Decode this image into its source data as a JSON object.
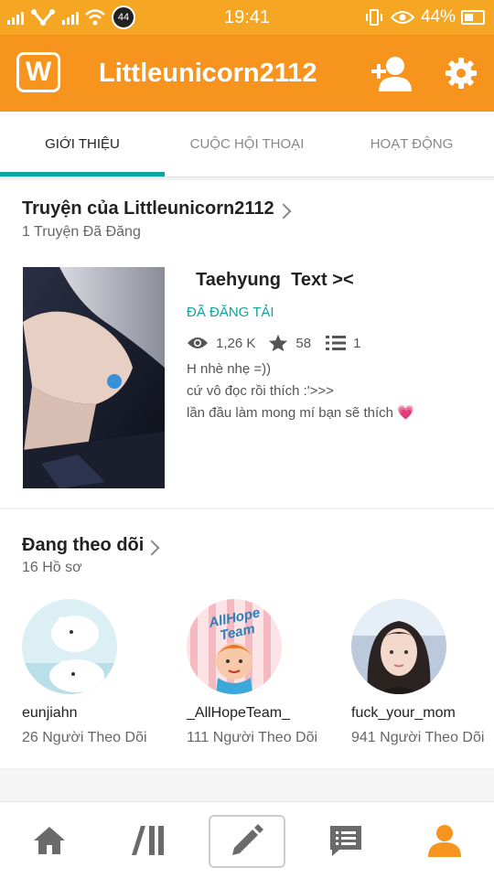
{
  "status_bar": {
    "time": "19:41",
    "notification_count": "44",
    "battery": "44%"
  },
  "app_bar": {
    "logo_letter": "W",
    "title": "Littleunicorn2112"
  },
  "tabs": [
    {
      "label": "GIỚI THIỆU",
      "active": true
    },
    {
      "label": "CUỘC HỘI THOẠI",
      "active": false
    },
    {
      "label": "HOẠT ĐỘNG",
      "active": false
    }
  ],
  "stories_section": {
    "title": "Truyện của Littleunicorn2112",
    "subtitle": "1 Truyện Đã Đăng",
    "story": {
      "title": "Taehyung  Text ><",
      "status": "ĐÃ ĐĂNG TẢI",
      "views": "1,26 K",
      "votes": "58",
      "parts": "1",
      "description": [
        "H nhè nhẹ =))",
        "cứ vô đọc rồi thích :'>>>",
        "lần đầu làm mong mí bạn sẽ thích 💗"
      ]
    }
  },
  "following_section": {
    "title": "Đang theo dõi",
    "subtitle": "16 Hồ sơ",
    "profiles": [
      {
        "username": "eunjiahn",
        "followers": "26 Người Theo Dõi"
      },
      {
        "username": "_AllHopeTeam_",
        "followers": "111 Người Theo Dõi",
        "avatar_text": "AllHope Team"
      },
      {
        "username": "fuck_your_mom",
        "followers": "941 Người Theo Dõi"
      }
    ]
  },
  "colors": {
    "status_bar": "#f5a623",
    "app_bar": "#f7941d",
    "accent": "#0fa4a0",
    "nav_active": "#f7941d"
  },
  "bottom_nav": [
    "home-icon",
    "library-icon",
    "write-icon",
    "messages-icon",
    "profile-icon"
  ]
}
